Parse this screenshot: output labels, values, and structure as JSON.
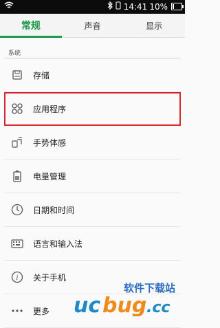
{
  "status_bar": {
    "time": "14:41",
    "battery": "10%"
  },
  "tabs": [
    {
      "label": "常规",
      "active": true
    },
    {
      "label": "声音",
      "active": false
    },
    {
      "label": "显示",
      "active": false
    }
  ],
  "section": {
    "title": "系统"
  },
  "items": [
    {
      "label": "存储",
      "icon": "storage-icon"
    },
    {
      "label": "应用程序",
      "icon": "apps-icon"
    },
    {
      "label": "手势体感",
      "icon": "gesture-icon"
    },
    {
      "label": "电量管理",
      "icon": "battery-icon"
    },
    {
      "label": "日期和时间",
      "icon": "clock-icon"
    },
    {
      "label": "语言和输入法",
      "icon": "keyboard-icon"
    },
    {
      "label": "关于手机",
      "icon": "info-icon"
    },
    {
      "label": "更多",
      "icon": "more-icon"
    }
  ],
  "watermark": {
    "text": "软件下载站",
    "brand": "ucbug.cc"
  },
  "colors": {
    "accent": "#1b9a4a",
    "highlight": "#d8282c"
  }
}
